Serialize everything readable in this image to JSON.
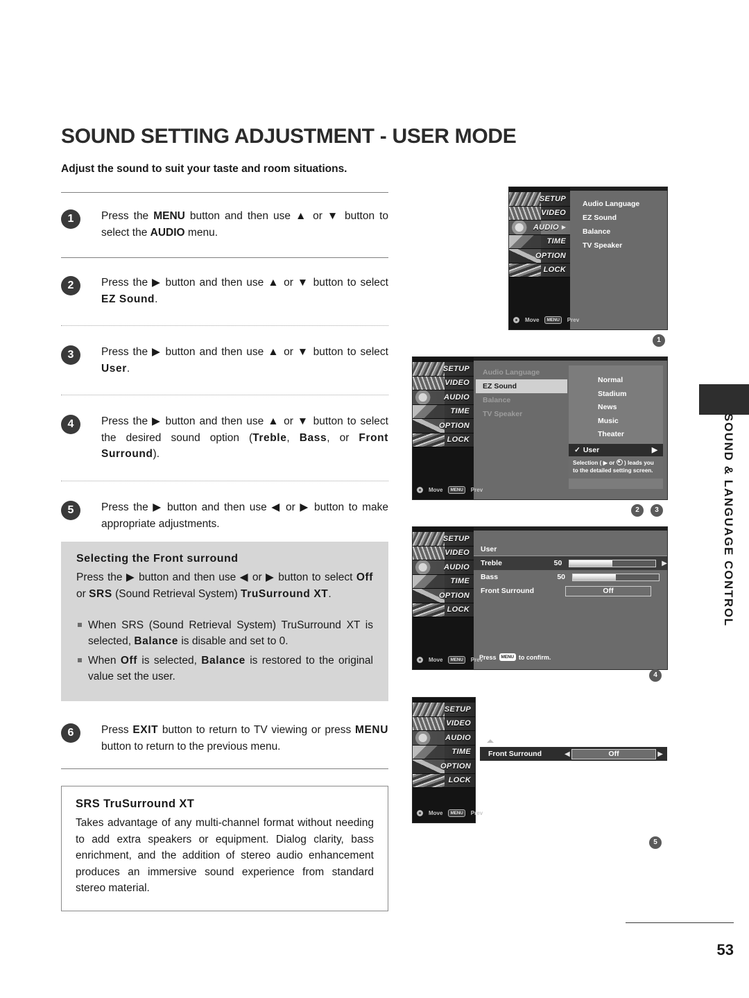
{
  "document": {
    "title": "SOUND SETTING ADJUSTMENT - USER MODE",
    "subtitle": "Adjust the sound to suit your taste and room situations.",
    "page_number": "53",
    "side_tab_label": "SOUND & LANGUAGE CONTROL"
  },
  "steps": [
    {
      "number": "1",
      "text_parts": {
        "p1": "Press the ",
        "b1": "MENU",
        "p2": " button and then use ",
        "arrow_up": "▲",
        "p3": " or ",
        "arrow_down": "▼",
        "p4": " button to select the ",
        "b2": "AUDIO",
        "p5": " menu."
      }
    },
    {
      "number": "2",
      "text_parts": {
        "p1": "Press the ",
        "arrow_right": "▶",
        "p2": " button and then use ",
        "arrow_up": "▲",
        "p3": " or ",
        "arrow_down": "▼",
        "p4": " button to select ",
        "b1": "EZ Sound",
        "p5": "."
      }
    },
    {
      "number": "3",
      "text_parts": {
        "p1": "Press the ",
        "arrow_right": "▶",
        "p2": " button and then use ",
        "arrow_up": "▲",
        "p3": " or ",
        "arrow_down": "▼",
        "p4": " button to select ",
        "b1": "User",
        "p5": "."
      }
    },
    {
      "number": "4",
      "text_parts": {
        "p1": "Press the ",
        "arrow_right": "▶",
        "p2": " button and then use ",
        "arrow_up": "▲",
        "p3": " or ",
        "arrow_down": "▼",
        "p4": " button to select the desired sound option (",
        "b1": "Treble",
        "p5": ", ",
        "b2": "Bass",
        "p6": ", or ",
        "b3": "Front Surround",
        "p7": ")."
      }
    },
    {
      "number": "5",
      "text_parts": {
        "p1": "Press the ",
        "arrow_right": "▶",
        "p2": " button and then use ",
        "arrow_left": "◀",
        "p3": " or ",
        "arrow_right2": "▶",
        "p4": " button to make appropriate adjustments."
      }
    },
    {
      "number": "6",
      "text_parts": {
        "p1": "Press ",
        "b1": "EXIT",
        "p2": " button to return to TV viewing or press ",
        "b2": "MENU",
        "p3": " button to return to the previous menu."
      }
    }
  ],
  "gray_box": {
    "heading": "Selecting the Front surround",
    "body": {
      "p1": "Press the ",
      "arrow_right": "▶",
      "p2": " button and then use ",
      "arrow_left": "◀",
      "p3": " or ",
      "arrow_right2": "▶",
      "p4": " button to select ",
      "b1": "Off",
      "p5": " or ",
      "b2": "SRS",
      "p6": " (Sound Retrieval System) ",
      "b3": "TruSurround XT",
      "p7": "."
    },
    "bullets": [
      {
        "p1": "When SRS (Sound Retrieval System) TruSurround XT is selected, ",
        "b1": "Balance",
        "p2": " is disable and set to 0."
      },
      {
        "p1": "When ",
        "b1": "Off",
        "p2": " is selected, ",
        "b2": "Balance",
        "p3": " is restored to the original value set the user."
      }
    ]
  },
  "srs_box": {
    "heading": "SRS TruSurround XT",
    "body": "Takes advantage of any multi-channel format without needing to add extra speakers or equipment. Dialog clarity, bass enrichment, and the addition of stereo audio enhancement produces an immersive sound experience from standard stereo material."
  },
  "osd": {
    "side_menu": [
      "SETUP",
      "VIDEO",
      "AUDIO",
      "TIME",
      "OPTION",
      "LOCK"
    ],
    "hint_move": "Move",
    "hint_prev": "Prev",
    "hint_prev_key": "MENU",
    "screen1": {
      "active_side_item": "AUDIO",
      "items": [
        "Audio Language",
        "EZ Sound",
        "Balance",
        "TV Speaker"
      ],
      "marker": "1"
    },
    "screen2": {
      "items": [
        "Audio Language",
        "EZ Sound",
        "Balance",
        "TV Speaker"
      ],
      "selected_item": "EZ Sound",
      "options": [
        "Normal",
        "Stadium",
        "News",
        "Music",
        "Theater"
      ],
      "checked_option": "User",
      "check_glyph": "✓",
      "note": "Selection (     or     ) leads you to the detailed setting screen.",
      "note_p1": "Selection ( ",
      "note_arrow": "▶",
      "note_p2": " or ",
      "note_p3": " ) leads you to the detailed setting screen.",
      "markers": [
        "2",
        "3"
      ]
    },
    "screen3": {
      "header": "User",
      "rows": [
        {
          "label": "Treble",
          "value": "50",
          "fill_percent": 50,
          "type": "slider",
          "highlighted": true
        },
        {
          "label": "Bass",
          "value": "50",
          "fill_percent": 50,
          "type": "slider",
          "highlighted": false
        },
        {
          "label": "Front Surround",
          "value": "Off",
          "type": "pill",
          "highlighted": false
        }
      ],
      "confirm_p1": "Press",
      "confirm_key": "MENU",
      "confirm_p2": "to confirm.",
      "marker": "4"
    },
    "screen4": {
      "label": "Front Surround",
      "value": "Off",
      "arrow_left": "◀",
      "arrow_right": "▶",
      "marker": "5"
    }
  }
}
